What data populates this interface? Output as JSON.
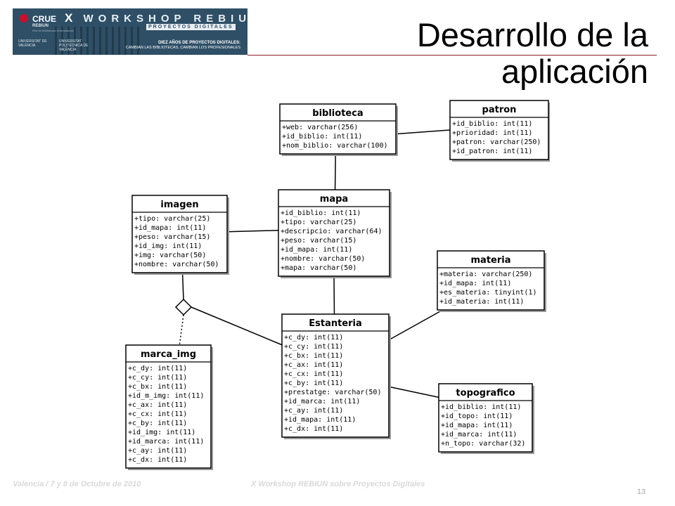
{
  "header": {
    "banner": {
      "org": "CRUE",
      "org_sub": "REBIUN",
      "org_sub2": "Red de Bibliotecas Universitarias",
      "title_x": "X",
      "title_rest": "WORKSHOP REBIUN",
      "subtitle": "PROYECTOS DIGITALES",
      "univ1": "UNIVERSITAT DE VALÈNCIA",
      "univ2": "UNIVERSITAT POLITÈCNICA DE VALÈNCIA",
      "tagline1": "DIEZ AÑOS DE PROYECTOS DIGITALES:",
      "tagline2": "CAMBIAN LAS BIBLIOTECAS, CAMBIAN LOS PROFESIONALES"
    },
    "title": "Desarrollo de la aplicación"
  },
  "diagram": {
    "entities": [
      {
        "key": "biblioteca",
        "name": "biblioteca",
        "attributes": [
          "+web: varchar(256)",
          "+id_biblio: int(11)",
          "+nom_biblio: varchar(100)"
        ]
      },
      {
        "key": "patron",
        "name": "patron",
        "attributes": [
          "+id_biblio: int(11)",
          "+prioridad: int(11)",
          "+patron: varchar(250)",
          "+id_patron: int(11)"
        ]
      },
      {
        "key": "imagen",
        "name": "imagen",
        "attributes": [
          "+tipo: varchar(25)",
          "+id_mapa: int(11)",
          "+peso: varchar(15)",
          "+id_img: int(11)",
          "+img: varchar(50)",
          "+nombre: varchar(50)"
        ]
      },
      {
        "key": "mapa",
        "name": "mapa",
        "attributes": [
          "+id_biblio: int(11)",
          "+tipo: varchar(25)",
          "+descripcio: varchar(64)",
          "+peso: varchar(15)",
          "+id_mapa: int(11)",
          "+nombre: varchar(50)",
          "+mapa: varchar(50)"
        ]
      },
      {
        "key": "materia",
        "name": "materia",
        "attributes": [
          "+materia: varchar(250)",
          "+id_mapa: int(11)",
          "+es_materia: tinyint(1)",
          "+id_materia: int(11)"
        ]
      },
      {
        "key": "estanteria",
        "name": "Estanteria",
        "attributes": [
          "+c_dy: int(11)",
          "+c_cy: int(11)",
          "+c_bx: int(11)",
          "+c_ax: int(11)",
          "+c_cx: int(11)",
          "+c_by: int(11)",
          "+prestatge: varchar(50)",
          "+id_marca: int(11)",
          "+c_ay: int(11)",
          "+id_mapa: int(11)",
          "+c_dx: int(11)"
        ]
      },
      {
        "key": "marca_img",
        "name": "marca_img",
        "attributes": [
          "+c_dy: int(11)",
          "+c_cy: int(11)",
          "+c_bx: int(11)",
          "+id_m_img: int(11)",
          "+c_ax: int(11)",
          "+c_cx: int(11)",
          "+c_by: int(11)",
          "+id_img: int(11)",
          "+id_marca: int(11)",
          "+c_ay: int(11)",
          "+c_dx: int(11)"
        ]
      },
      {
        "key": "topografico",
        "name": "topografico",
        "attributes": [
          "+id_biblio: int(11)",
          "+id_topo: int(11)",
          "+id_mapa: int(11)",
          "+id_marca: int(11)",
          "+n_topo: varchar(32)"
        ]
      }
    ],
    "relations": [
      {
        "from": "biblioteca",
        "to": "patron",
        "style": "solid"
      },
      {
        "from": "biblioteca",
        "to": "mapa",
        "style": "solid"
      },
      {
        "from": "imagen",
        "to": "mapa",
        "style": "solid"
      },
      {
        "from": "mapa",
        "to": "estanteria",
        "style": "solid"
      },
      {
        "from": "materia",
        "to": "estanteria",
        "style": "solid"
      },
      {
        "from": "topografico",
        "to": "estanteria",
        "style": "solid"
      },
      {
        "from": "imagen",
        "to": "association",
        "style": "solid"
      },
      {
        "from": "association",
        "to": "estanteria",
        "style": "solid"
      },
      {
        "from": "association",
        "to": "marca_img",
        "style": "dotted"
      }
    ]
  },
  "footer": {
    "left": "Valencia / 7 y 8 de Octubre de 2010",
    "center": "X Workshop REBIUN sobre Proyectos Digitales",
    "page": "13"
  }
}
